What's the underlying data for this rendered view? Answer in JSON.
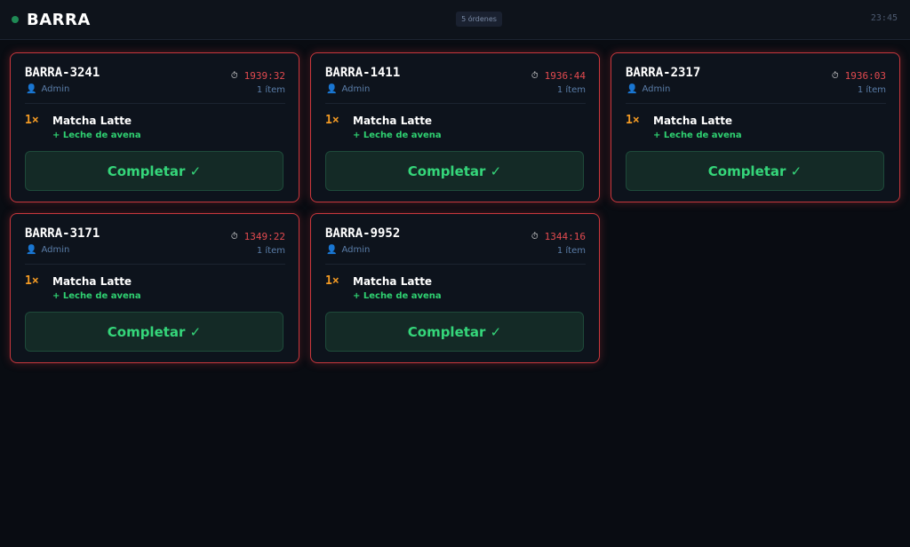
{
  "header": {
    "title": "BARRA",
    "order_count": "5 órdenes",
    "time": "23:45"
  },
  "orders": [
    {
      "id": "BARRA-3241",
      "timer": "1939:32",
      "user": "Admin",
      "items_count": "1 ítem",
      "qty": "1×",
      "item": "Matcha Latte",
      "modifier": "+ Leche de avena",
      "button": "Completar ✓"
    },
    {
      "id": "BARRA-1411",
      "timer": "1936:44",
      "user": "Admin",
      "items_count": "1 ítem",
      "qty": "1×",
      "item": "Matcha Latte",
      "modifier": "+ Leche de avena",
      "button": "Completar ✓"
    },
    {
      "id": "BARRA-2317",
      "timer": "1936:03",
      "user": "Admin",
      "items_count": "1 ítem",
      "qty": "1×",
      "item": "Matcha Latte",
      "modifier": "+ Leche de avena",
      "button": "Completar ✓"
    },
    {
      "id": "BARRA-3171",
      "timer": "1349:22",
      "user": "Admin",
      "items_count": "1 ítem",
      "qty": "1×",
      "item": "Matcha Latte",
      "modifier": "+ Leche de avena",
      "button": "Completar ✓"
    },
    {
      "id": "BARRA-9952",
      "timer": "1344:16",
      "user": "Admin",
      "items_count": "1 ítem",
      "qty": "1×",
      "item": "Matcha Latte",
      "modifier": "+ Leche de avena",
      "button": "Completar ✓"
    }
  ],
  "icons": {
    "timer": "stopwatch-icon",
    "user": "user-icon",
    "status": "status-dot-icon"
  },
  "colors": {
    "accent": "#35d67a",
    "alert": "#e24a4f",
    "quantity": "#f29a24",
    "background": "#090c12"
  }
}
